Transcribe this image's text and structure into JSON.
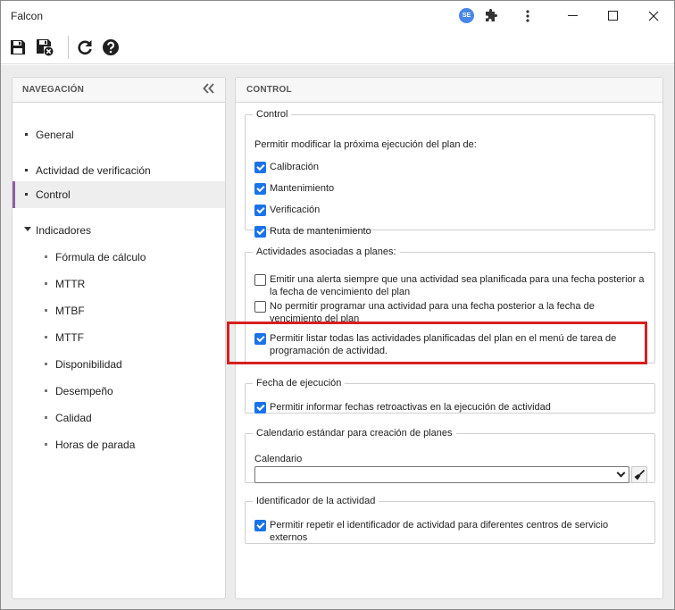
{
  "window": {
    "title": "Falcon",
    "extension_badge": "SE",
    "icons": [
      "se-extension-icon",
      "puzzle-icon",
      "kebab-menu-icon",
      "minimize-icon",
      "maximize-icon",
      "close-icon"
    ]
  },
  "toolbar": {
    "icons": [
      "save-icon",
      "save-and-close-icon",
      "refresh-icon",
      "help-icon"
    ]
  },
  "sidebar": {
    "header": "NAVEGACIÓN",
    "items": [
      {
        "label": "General"
      },
      {
        "label": "Actividad de verificación"
      },
      {
        "label": "Control",
        "active": true
      },
      {
        "label": "Indicadores",
        "expanded": true
      }
    ],
    "subitems": [
      {
        "label": "Fórmula de cálculo"
      },
      {
        "label": "MTTR"
      },
      {
        "label": "MTBF"
      },
      {
        "label": "MTTF"
      },
      {
        "label": "Disponibilidad"
      },
      {
        "label": "Desempeño"
      },
      {
        "label": "Calidad"
      },
      {
        "label": "Horas de parada"
      }
    ]
  },
  "main": {
    "header": "CONTROL",
    "control": {
      "legend": "Control",
      "intro": "Permitir modificar la próxima ejecución del plan de:",
      "options": [
        {
          "label": "Calibración",
          "checked": true
        },
        {
          "label": "Mantenimiento",
          "checked": true
        },
        {
          "label": "Verificación",
          "checked": true
        },
        {
          "label": "Ruta de mantenimiento",
          "checked": true
        }
      ]
    },
    "activities": {
      "legend": "Actividades asociadas a planes:",
      "options": [
        {
          "label": "Emitir una alerta siempre que una actividad sea planificada para una fecha posterior a la fecha de vencimiento del plan",
          "checked": false
        },
        {
          "label": "No permitir programar una actividad para una fecha posterior a la fecha de vencimiento del plan",
          "checked": false
        },
        {
          "label": "Permitir listar todas las actividades planificadas del plan en el menú de tarea de programación de actividad.",
          "checked": true
        }
      ]
    },
    "execution_date": {
      "legend": "Fecha de ejecución",
      "options": [
        {
          "label": "Permitir informar fechas retroactivas en la ejecución de actividad",
          "checked": true
        }
      ]
    },
    "calendar": {
      "legend": "Calendario estándar para creación de planes",
      "field_label": "Calendario",
      "value": ""
    },
    "identifier": {
      "legend": "Identificador de la actividad",
      "options": [
        {
          "label": "Permitir repetir el identificador de actividad para diferentes centros de servicio externos",
          "checked": true
        }
      ]
    }
  },
  "colors": {
    "accent_active": "#8e5ea2",
    "checkbox": "#1a73e8",
    "highlight": "#d62020"
  }
}
